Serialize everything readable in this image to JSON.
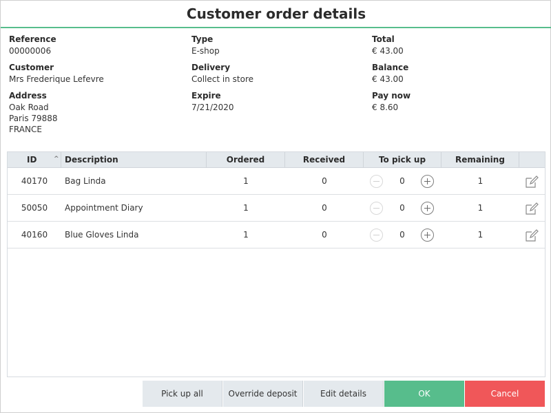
{
  "dialog": {
    "title": "Customer order details"
  },
  "info": {
    "reference": {
      "label": "Reference",
      "value": "00000006"
    },
    "customer": {
      "label": "Customer",
      "value": "Mrs Frederique Lefevre"
    },
    "address": {
      "label": "Address",
      "lines": [
        "Oak Road",
        "Paris 79888",
        "FRANCE"
      ]
    },
    "type": {
      "label": "Type",
      "value": "E-shop"
    },
    "delivery": {
      "label": "Delivery",
      "value": "Collect in store"
    },
    "expire": {
      "label": "Expire",
      "value": "7/21/2020"
    },
    "total": {
      "label": "Total",
      "value": "€ 43.00"
    },
    "balance": {
      "label": "Balance",
      "value": "€ 43.00"
    },
    "pay_now": {
      "label": "Pay now",
      "value": "€ 8.60"
    }
  },
  "table": {
    "columns": {
      "id": "ID",
      "description": "Description",
      "ordered": "Ordered",
      "received": "Received",
      "to_pick_up": "To pick up",
      "remaining": "Remaining"
    },
    "sort_icon": "caret-up-icon",
    "rows": [
      {
        "id": "40170",
        "description": "Bag Linda",
        "ordered": "1",
        "received": "0",
        "to_pick_up": "0",
        "remaining": "1"
      },
      {
        "id": "50050",
        "description": "Appointment Diary",
        "ordered": "1",
        "received": "0",
        "to_pick_up": "0",
        "remaining": "1"
      },
      {
        "id": "40160",
        "description": "Blue Gloves Linda",
        "ordered": "1",
        "received": "0",
        "to_pick_up": "0",
        "remaining": "1"
      }
    ]
  },
  "footer": {
    "pick_up_all": "Pick up all",
    "override_deposit": "Override deposit",
    "edit_details": "Edit details",
    "ok": "OK",
    "cancel": "Cancel"
  },
  "colors": {
    "accent_green": "#57bd8c",
    "cancel_red": "#f05759",
    "header_grey": "#e4e9ed"
  }
}
